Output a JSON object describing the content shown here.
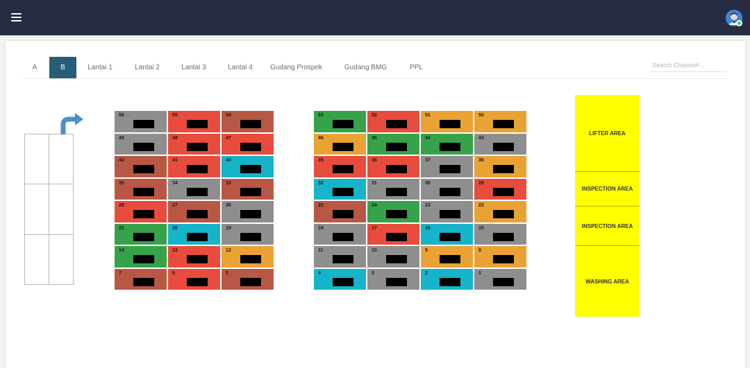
{
  "topbar": {
    "menu_icon": "hamburger-menu-icon",
    "avatar_icon": "user-avatar-icon",
    "colors": {
      "background": "#262c42",
      "online_dot": "#3cc46a"
    }
  },
  "tabs": [
    {
      "label": "A",
      "active": false
    },
    {
      "label": "B",
      "active": true
    },
    {
      "label": "Lantai 1",
      "active": false
    },
    {
      "label": "Lantai 2",
      "active": false
    },
    {
      "label": "Lantai 3",
      "active": false
    },
    {
      "label": "Lantai 4",
      "active": false
    },
    {
      "label": "Gudang Prospek",
      "active": false
    },
    {
      "label": "Gudang BMG",
      "active": false
    },
    {
      "label": "PPL",
      "active": false
    }
  ],
  "search": {
    "placeholder": "Search Chassis#..."
  },
  "colors": {
    "grey": "#8e8e8e",
    "red": "#e74c3c",
    "brown": "#b95745",
    "cyan": "#17b3c9",
    "green": "#36a24a",
    "orange": "#eaa235",
    "yellow": "#ffff00",
    "active_tab": "#285d78"
  },
  "entry_icon": "turn-arrow-icon",
  "left_grid": [
    {
      "num": "56",
      "color": "grey"
    },
    {
      "num": "55",
      "color": "red"
    },
    {
      "num": "54",
      "color": "brown"
    },
    {
      "num": "49",
      "color": "grey"
    },
    {
      "num": "48",
      "color": "red"
    },
    {
      "num": "47",
      "color": "red"
    },
    {
      "num": "42",
      "color": "brown"
    },
    {
      "num": "41",
      "color": "red"
    },
    {
      "num": "40",
      "color": "cyan"
    },
    {
      "num": "35",
      "color": "brown"
    },
    {
      "num": "34",
      "color": "grey"
    },
    {
      "num": "33",
      "color": "brown"
    },
    {
      "num": "28",
      "color": "red"
    },
    {
      "num": "27",
      "color": "brown"
    },
    {
      "num": "26",
      "color": "grey"
    },
    {
      "num": "21",
      "color": "green"
    },
    {
      "num": "20",
      "color": "cyan"
    },
    {
      "num": "19",
      "color": "grey"
    },
    {
      "num": "14",
      "color": "green"
    },
    {
      "num": "13",
      "color": "red"
    },
    {
      "num": "12",
      "color": "orange"
    },
    {
      "num": "7",
      "color": "brown"
    },
    {
      "num": "6",
      "color": "red"
    },
    {
      "num": "5",
      "color": "brown"
    }
  ],
  "right_grid": [
    {
      "num": "53",
      "color": "green"
    },
    {
      "num": "52",
      "color": "red"
    },
    {
      "num": "51",
      "color": "orange"
    },
    {
      "num": "50",
      "color": "orange"
    },
    {
      "num": "46",
      "color": "orange"
    },
    {
      "num": "45",
      "color": "green"
    },
    {
      "num": "44",
      "color": "green"
    },
    {
      "num": "43",
      "color": "grey"
    },
    {
      "num": "39",
      "color": "red"
    },
    {
      "num": "38",
      "color": "red"
    },
    {
      "num": "37",
      "color": "grey"
    },
    {
      "num": "36",
      "color": "orange"
    },
    {
      "num": "32",
      "color": "cyan"
    },
    {
      "num": "31",
      "color": "grey"
    },
    {
      "num": "30",
      "color": "grey"
    },
    {
      "num": "29",
      "color": "red"
    },
    {
      "num": "25",
      "color": "brown"
    },
    {
      "num": "24",
      "color": "green"
    },
    {
      "num": "23",
      "color": "grey"
    },
    {
      "num": "22",
      "color": "orange"
    },
    {
      "num": "18",
      "color": "grey"
    },
    {
      "num": "17",
      "color": "red"
    },
    {
      "num": "16",
      "color": "cyan"
    },
    {
      "num": "15",
      "color": "grey"
    },
    {
      "num": "11",
      "color": "grey"
    },
    {
      "num": "10",
      "color": "grey"
    },
    {
      "num": "9",
      "color": "orange"
    },
    {
      "num": "8",
      "color": "orange"
    },
    {
      "num": "4",
      "color": "cyan"
    },
    {
      "num": "3",
      "color": "grey"
    },
    {
      "num": "2",
      "color": "cyan"
    },
    {
      "num": "1",
      "color": "grey"
    }
  ],
  "areas": [
    {
      "label": "LIFTER AREA"
    },
    {
      "label": "INSPECTION AREA"
    },
    {
      "label": "INSPECTION AREA"
    },
    {
      "label": "WASHING AREA"
    }
  ]
}
